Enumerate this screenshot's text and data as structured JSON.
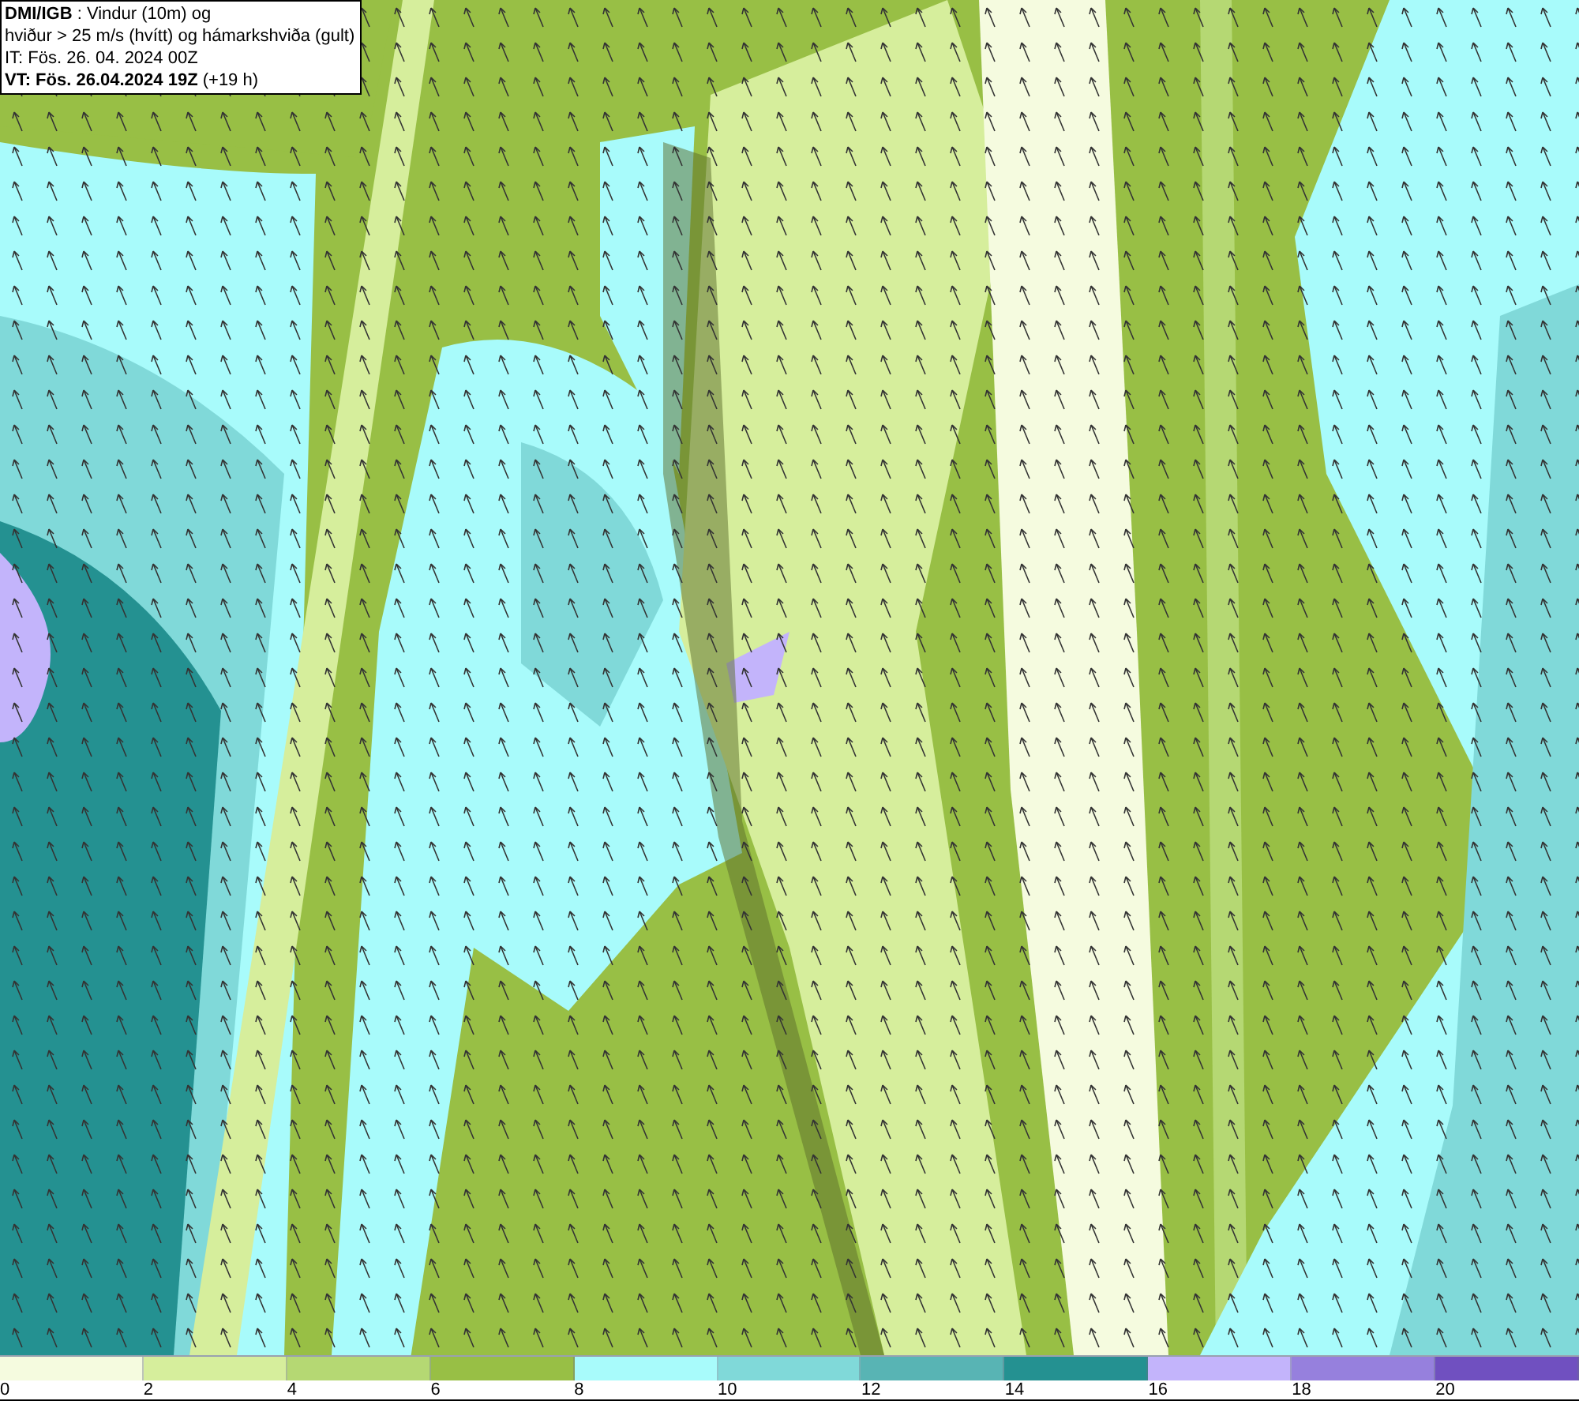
{
  "title_box": {
    "lines": [
      "**DMI/IGB** : Vindur (10m) og",
      "hviður > 25 m/s (hvítt) og hámarkshviða (gult)",
      "IT: Fös. 26. 04. 2024 00Z",
      "**VT: Fös. 26.04.2024 19Z** (+19 h)"
    ]
  },
  "legend": {
    "segments": [
      {
        "color": "#f5fbdf"
      },
      {
        "color": "#d6ee9c"
      },
      {
        "color": "#b5d873"
      },
      {
        "color": "#98bf45"
      },
      {
        "color": "#a8fbfb"
      },
      {
        "color": "#80d9d9"
      },
      {
        "color": "#58b4b4"
      },
      {
        "color": "#249191"
      },
      {
        "color": "#c3b4fb"
      },
      {
        "color": "#9680dd"
      },
      {
        "color": "#7050c0"
      }
    ],
    "labels": [
      "0",
      "2",
      "4",
      "6",
      "8",
      "10",
      "12",
      "14",
      "16",
      "18",
      "20"
    ]
  }
}
